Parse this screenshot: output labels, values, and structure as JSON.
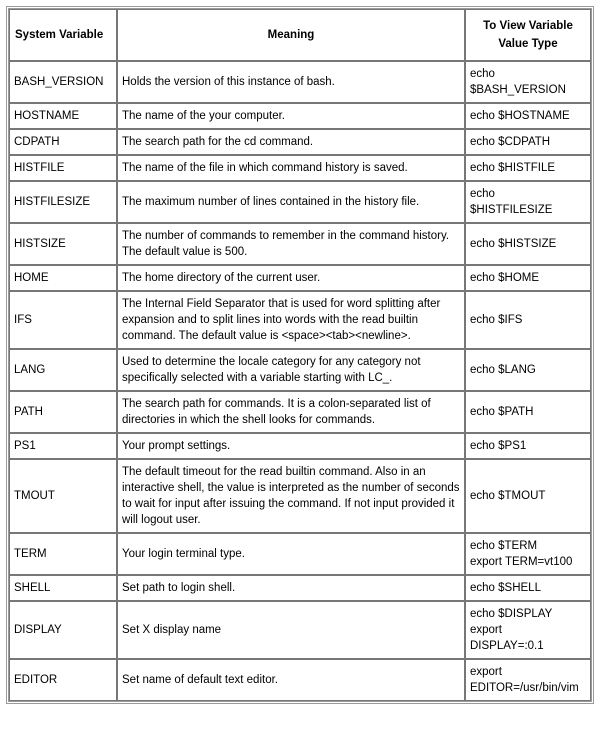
{
  "table": {
    "caption": "",
    "columns": [
      {
        "key": "variable",
        "label": "System Variable"
      },
      {
        "key": "meaning",
        "label": "Meaning"
      },
      {
        "key": "view",
        "label": "To View Variable\nValue Type"
      }
    ],
    "header": {
      "col1": "System Variable",
      "col2": "Meaning",
      "col3_line1": "To View Variable",
      "col3_line2": "Value Type"
    },
    "rows": [
      {
        "variable": "BASH_VERSION",
        "meaning": "Holds the version of this instance of bash.",
        "view_lines": [
          "echo",
          "$BASH_VERSION"
        ]
      },
      {
        "variable": "HOSTNAME",
        "meaning": "The name of the your computer.",
        "view_lines": [
          "echo $HOSTNAME"
        ]
      },
      {
        "variable": "CDPATH",
        "meaning": "The search path for the cd command.",
        "view_lines": [
          "echo $CDPATH"
        ]
      },
      {
        "variable": "HISTFILE",
        "meaning": "The name of the file in which command history is saved.",
        "view_lines": [
          "echo $HISTFILE"
        ]
      },
      {
        "variable": "HISTFILESIZE",
        "meaning": "The maximum number of lines contained in the history file.",
        "view_lines": [
          "echo",
          "$HISTFILESIZE"
        ]
      },
      {
        "variable": "HISTSIZE",
        "meaning": "The number of commands to remember in the command history. The default value is 500.",
        "view_lines": [
          "echo $HISTSIZE"
        ]
      },
      {
        "variable": "HOME",
        "meaning": "The home directory of the current user.",
        "view_lines": [
          "echo $HOME"
        ]
      },
      {
        "variable": "IFS",
        "meaning": "The Internal Field Separator that is used for word splitting after expansion and to split lines into words with the read builtin command. The default value is <space><tab><newline>.",
        "view_lines": [
          "echo $IFS"
        ]
      },
      {
        "variable": "LANG",
        "meaning": "Used to determine the locale category for any category not specifically selected with a variable starting with LC_.",
        "view_lines": [
          "echo $LANG"
        ]
      },
      {
        "variable": "PATH",
        "meaning": "The search path for commands. It is a colon-separated list of directories in which the shell looks for commands.",
        "view_lines": [
          "echo $PATH"
        ]
      },
      {
        "variable": "PS1",
        "meaning": "Your prompt settings.",
        "view_lines": [
          "echo $PS1"
        ]
      },
      {
        "variable": "TMOUT",
        "meaning": "The default timeout for the read builtin command. Also in an interactive shell, the value is interpreted as the number of seconds to wait for input after issuing the command. If not input provided it will logout user.",
        "view_lines": [
          "echo $TMOUT"
        ]
      },
      {
        "variable": "TERM",
        "meaning": "Your login terminal type.",
        "view_lines": [
          "echo $TERM",
          "export TERM=vt100"
        ]
      },
      {
        "variable": "SHELL",
        "meaning": "Set path to login shell.",
        "view_lines": [
          "echo $SHELL"
        ]
      },
      {
        "variable": "DISPLAY",
        "meaning": "Set X display name",
        "view_lines": [
          "echo $DISPLAY",
          "export",
          "DISPLAY=:0.1"
        ]
      },
      {
        "variable": "EDITOR",
        "meaning": "Set name of default text editor.",
        "view_lines": [
          "export",
          "EDITOR=/usr/bin/vim"
        ]
      }
    ]
  },
  "style": {
    "text_color": "#000000",
    "background": "#ffffff",
    "border_color": "#777777",
    "outer_border_color": "#9a9a9a"
  }
}
